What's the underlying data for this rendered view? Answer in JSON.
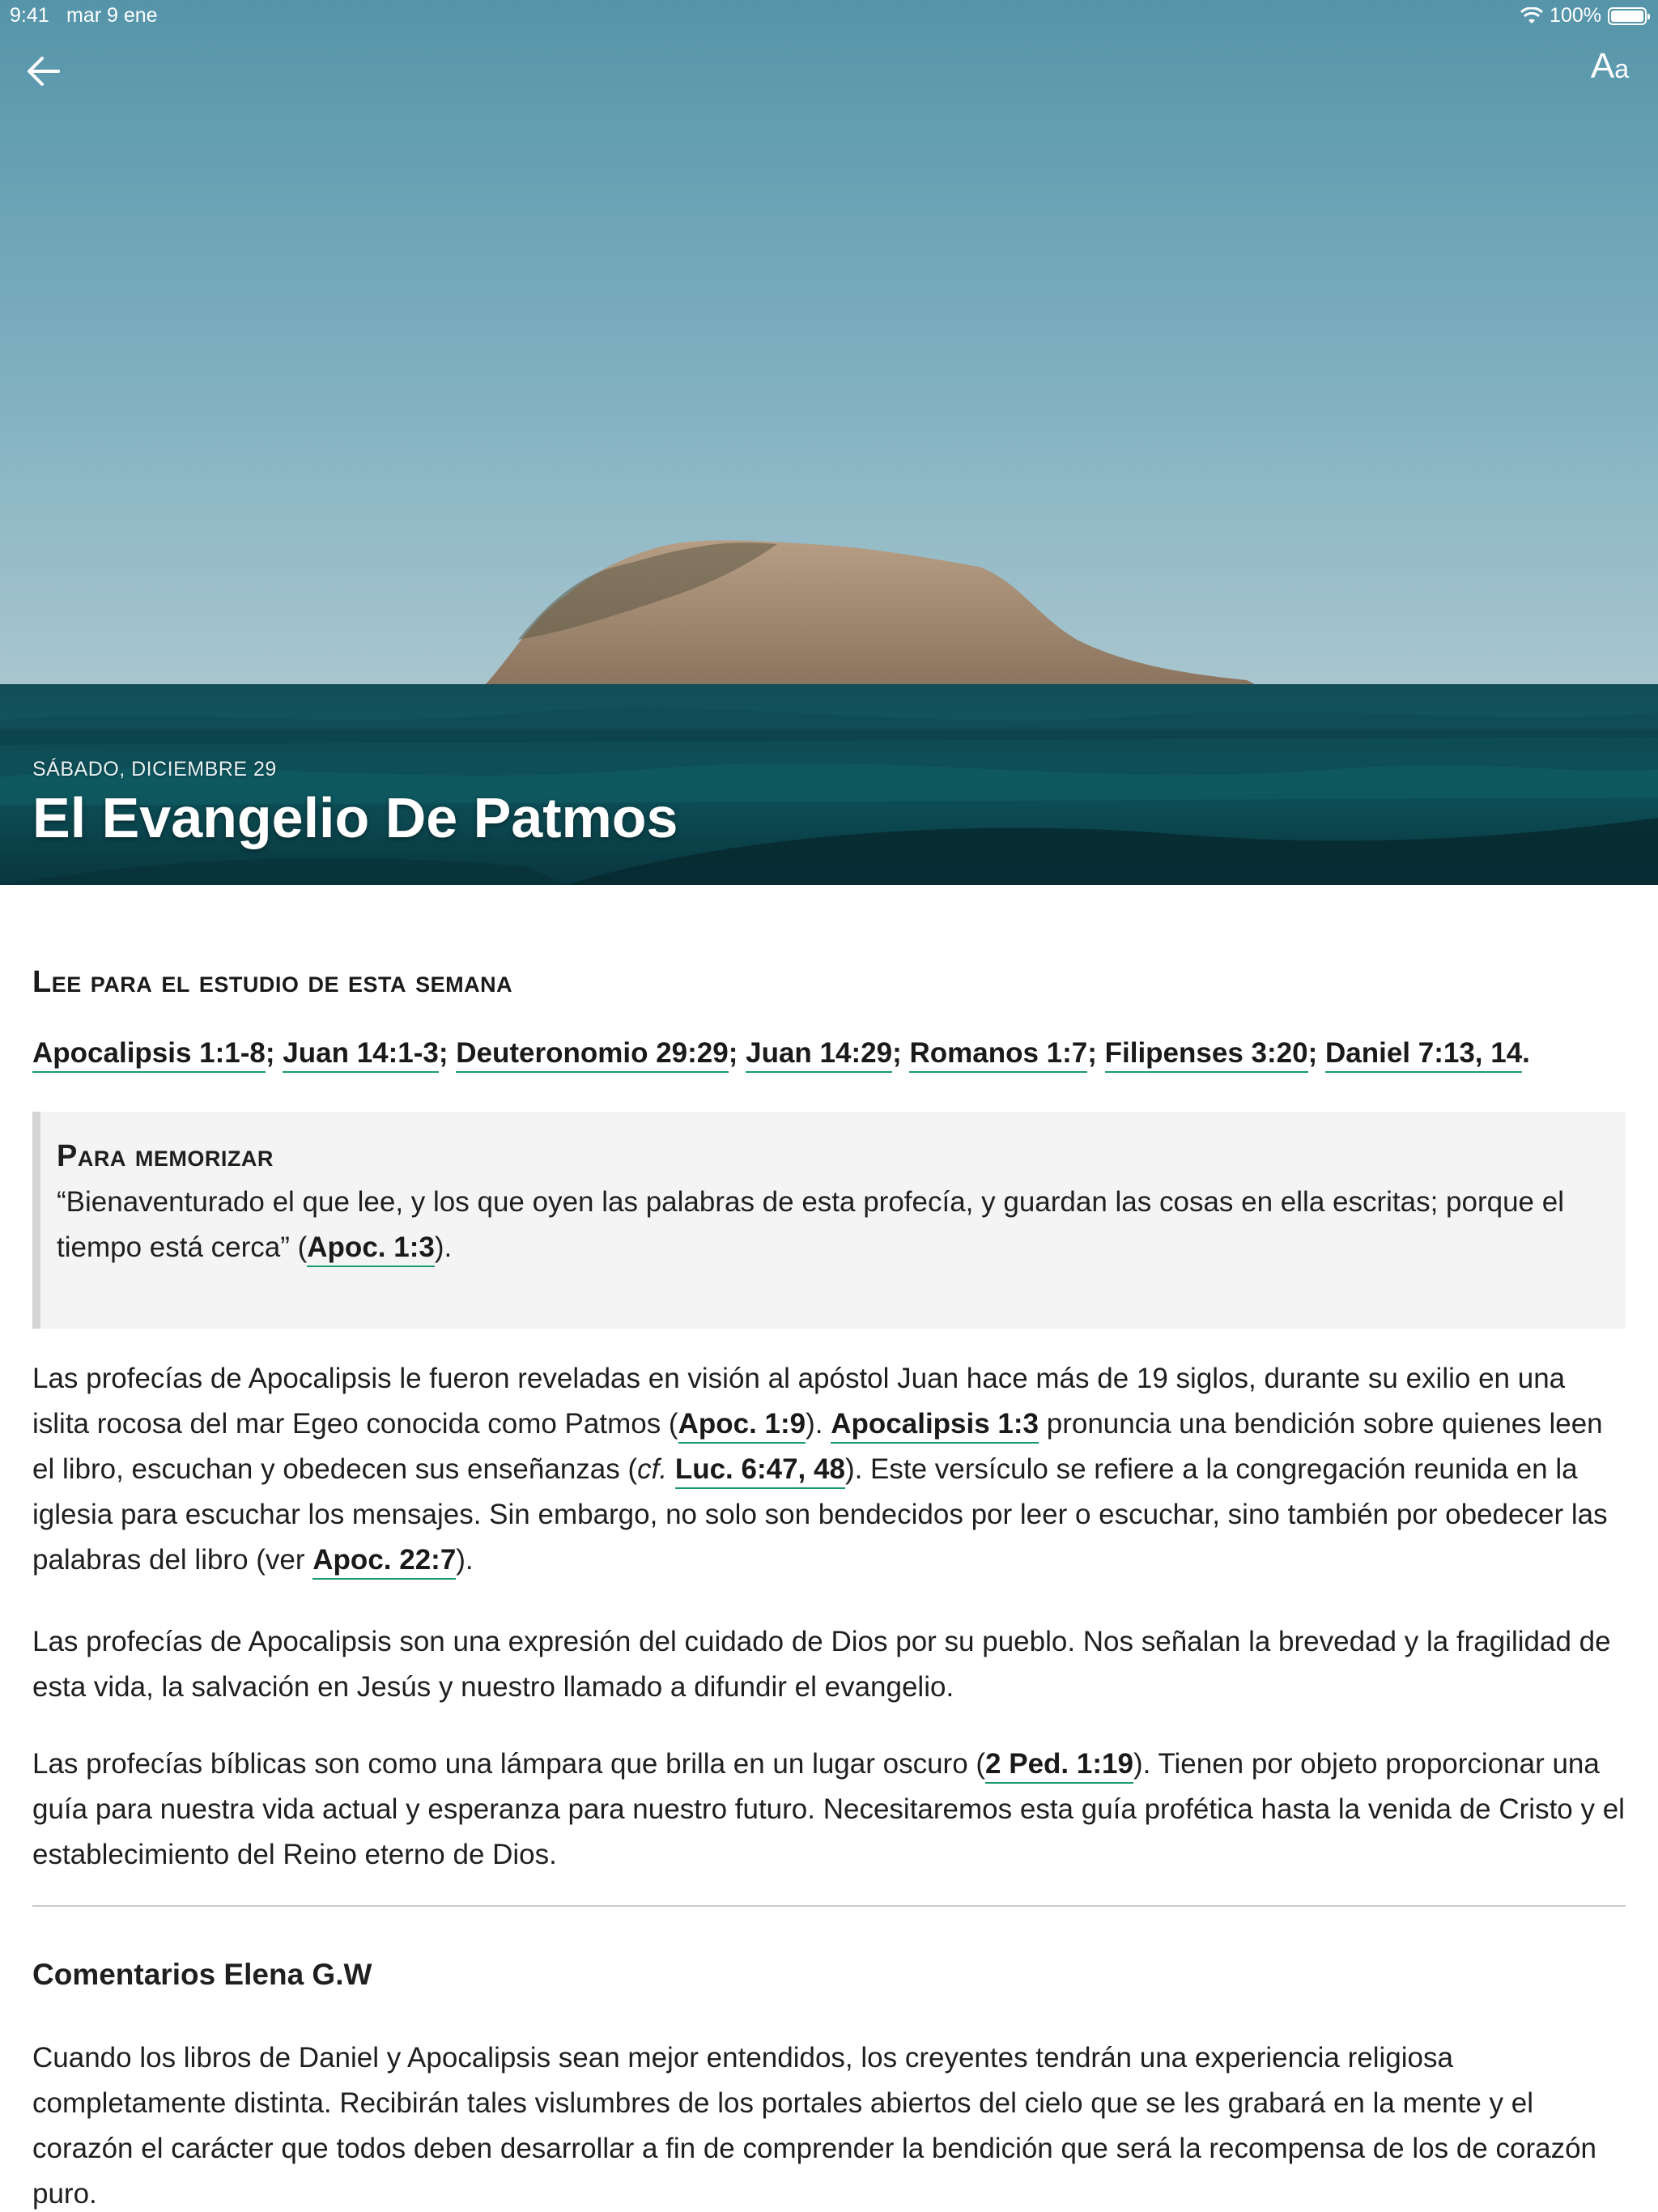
{
  "status_bar": {
    "time": "9:41",
    "date": "mar 9 ene",
    "battery": "100%"
  },
  "header": {
    "back_icon": "arrow-left-icon",
    "font_size_big": "A",
    "font_size_small": "a",
    "date": "SÁBADO, DICIEMBRE 29",
    "title": "El Evangelio De Patmos"
  },
  "reading": {
    "title": "Lee para el estudio de esta semana",
    "refs": [
      "Apocalipsis 1:1-8",
      "Juan 14:1-3",
      "Deuteronomio 29:29",
      "Juan 14:29",
      "Romanos 1:7",
      "Filipenses 3:20",
      "Daniel 7:13, 14"
    ],
    "sep": "; ",
    "end": "."
  },
  "memory": {
    "title": "Para memorizar",
    "text": "“Bienaventurado el que lee, y los que oyen las palabras de esta profecía, y guardan las cosas en ella escritas; porque el tiempo está cerca” (",
    "ref": "Apoc. 1:3",
    "end": ")."
  },
  "paragraph1": {
    "t1": "Las profecías de Apocalipsis le fueron reveladas en visión al apóstol Juan hace más de 19 siglos, durante su exilio en una islita rocosa del mar Egeo conocida como Patmos (",
    "r1": "Apoc. 1:9",
    "t2": "). ",
    "r2": "Apocalipsis 1:3",
    "t3": " pronuncia una bendición sobre quienes leen el libro, escuchan y obedecen sus enseñanzas (",
    "cf": "cf.",
    "t4": " ",
    "r3": "Luc. 6:47, 48",
    "t5": "). Este versículo se refiere a la congregación reunida en la iglesia para escuchar los mensajes. Sin embargo, no solo son bendecidos por leer o escuchar, sino también por obedecer las palabras del libro (ver ",
    "r4": "Apoc. 22:7",
    "t6": ")."
  },
  "paragraph2": "Las profecías de Apocalipsis son una expresión del cuidado de Dios por su pueblo. Nos señalan la brevedad y la fragilidad de esta vida, la salvación en Jesús y nuestro llamado a difundir el evangelio.",
  "paragraph3": {
    "t1": "Las profecías bíblicas son como una lámpara que brilla en un lugar oscuro (",
    "r1": "2 Ped. 1:19",
    "t2": "). Tienen por objeto proporcionar una guía para nuestra vida actual y esperanza para nuestro futuro. Necesitaremos esta guía profética hasta la venida de Cristo y el establecimiento del Reino eterno de Dios."
  },
  "comments": {
    "title": "Comentarios Elena G.W",
    "text": "Cuando los libros de Daniel y Apocalipsis sean mejor entendidos, los creyentes tendrán una experiencia religiosa completamente distinta. Recibirán tales vislumbres de los portales abiertos del cielo que se les grabará en la mente y el corazón el carácter que todos deben desarrollar a fin de comprender la bendición que será la recompensa de los de corazón puro."
  },
  "colors": {
    "link_underline": "#1a9a6a",
    "sky": "#5e9bb0",
    "sea": "#0f5a63"
  }
}
